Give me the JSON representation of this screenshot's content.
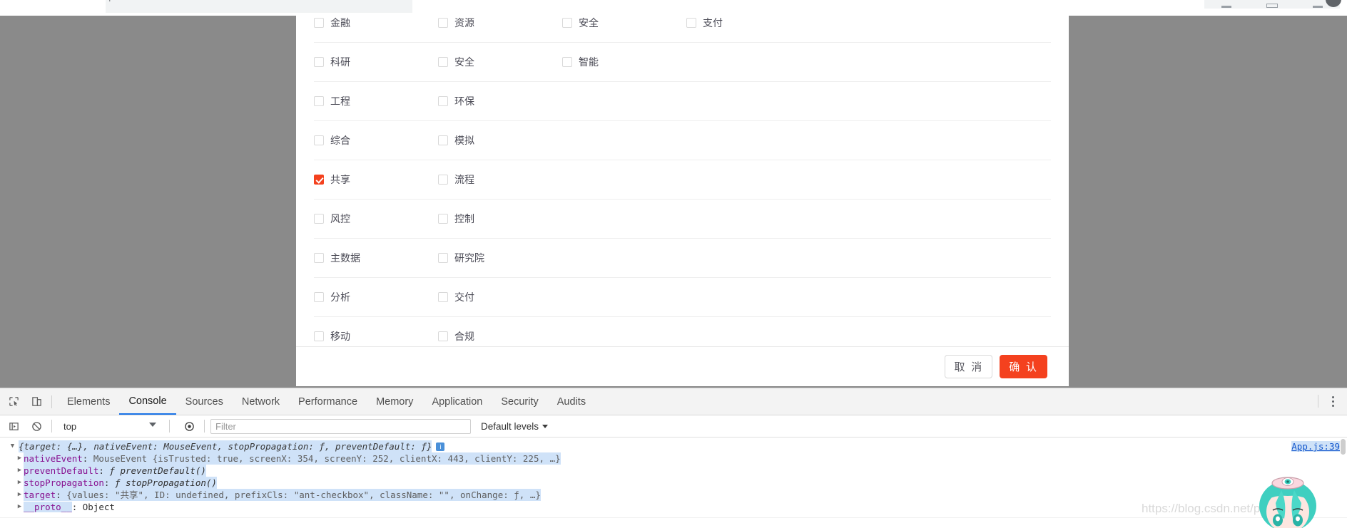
{
  "browser": {
    "tab_plus_label": "+",
    "window_controls": [
      "minimize",
      "maximize",
      "close"
    ]
  },
  "modal": {
    "checkbox_grid": {
      "rows": [
        [
          {
            "label": "金融",
            "checked": false
          },
          {
            "label": "资源",
            "checked": false
          },
          {
            "label": "安全",
            "checked": false
          },
          {
            "label": "支付",
            "checked": false
          }
        ],
        [
          {
            "label": "科研",
            "checked": false
          },
          {
            "label": "安全",
            "checked": false
          },
          {
            "label": "智能",
            "checked": false
          }
        ],
        [
          {
            "label": "工程",
            "checked": false
          },
          {
            "label": "环保",
            "checked": false
          }
        ],
        [
          {
            "label": "综合",
            "checked": false
          },
          {
            "label": "模拟",
            "checked": false
          }
        ],
        [
          {
            "label": "共享",
            "checked": true
          },
          {
            "label": "流程",
            "checked": false
          }
        ],
        [
          {
            "label": "风控",
            "checked": false
          },
          {
            "label": "控制",
            "checked": false
          }
        ],
        [
          {
            "label": "主数据",
            "checked": false
          },
          {
            "label": "研究院",
            "checked": false
          }
        ],
        [
          {
            "label": "分析",
            "checked": false
          },
          {
            "label": "交付",
            "checked": false
          }
        ],
        [
          {
            "label": "移动",
            "checked": false
          },
          {
            "label": "合规",
            "checked": false
          }
        ]
      ]
    },
    "footer": {
      "cancel_label": "取 消",
      "confirm_label": "确 认",
      "confirm_color": "#f4411e"
    }
  },
  "devtools": {
    "tabs": [
      {
        "label": "Elements",
        "active": false
      },
      {
        "label": "Console",
        "active": true
      },
      {
        "label": "Sources",
        "active": false
      },
      {
        "label": "Network",
        "active": false
      },
      {
        "label": "Performance",
        "active": false
      },
      {
        "label": "Memory",
        "active": false
      },
      {
        "label": "Application",
        "active": false
      },
      {
        "label": "Security",
        "active": false
      },
      {
        "label": "Audits",
        "active": false
      }
    ],
    "active_tab_underline_color": "#1a73e8",
    "toolbar": {
      "context_value": "top",
      "filter_placeholder": "Filter",
      "filter_value": "",
      "levels_label": "Default levels"
    },
    "console": {
      "source_link": "App.js:39",
      "message": {
        "preview": "{target: {…}, nativeEvent: MouseEvent, stopPropagation: ƒ, preventDefault: ƒ}",
        "rows": [
          {
            "key": "nativeEvent",
            "value": "MouseEvent {isTrusted: true, screenX: 354, screenY: 252, clientX: 443, clientY: 225, …}"
          },
          {
            "key": "preventDefault",
            "value": "ƒ preventDefault()"
          },
          {
            "key": "stopPropagation",
            "value": "ƒ stopPropagation()"
          },
          {
            "key": "target",
            "value": "{values: \"共享\", ID: undefined, prefixCls: \"ant-checkbox\", className: \"\", onChange: ƒ, …}"
          },
          {
            "key": "__proto__",
            "value": ": Object"
          }
        ]
      }
    }
  },
  "watermark": {
    "url": "https://blog.csdn.net/pengtiandi"
  }
}
